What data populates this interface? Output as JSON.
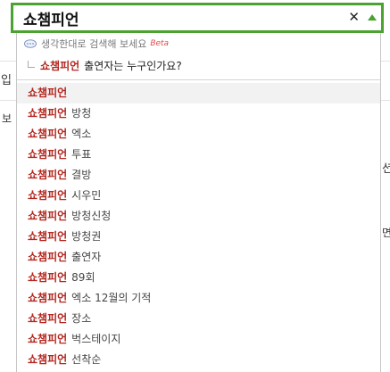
{
  "search": {
    "value": "쇼챔피언",
    "clear_symbol": "✕"
  },
  "dropdown": {
    "header": "생각한대로 검색해 보세요",
    "beta": "Beta",
    "question": {
      "keyword": "쇼챔피언",
      "rest": "출연자는 누구인가요?"
    },
    "items": [
      {
        "keyword": "쇼챔피언",
        "suffix": ""
      },
      {
        "keyword": "쇼챔피언",
        "suffix": "방청"
      },
      {
        "keyword": "쇼챔피언",
        "suffix": "엑소"
      },
      {
        "keyword": "쇼챔피언",
        "suffix": "투표"
      },
      {
        "keyword": "쇼챔피언",
        "suffix": "결방"
      },
      {
        "keyword": "쇼챔피언",
        "suffix": "시우민"
      },
      {
        "keyword": "쇼챔피언",
        "suffix": "방청신청"
      },
      {
        "keyword": "쇼챔피언",
        "suffix": "방청권"
      },
      {
        "keyword": "쇼챔피언",
        "suffix": "출연자"
      },
      {
        "keyword": "쇼챔피언",
        "suffix": "89회"
      },
      {
        "keyword": "쇼챔피언",
        "suffix": "엑소 12월의 기적"
      },
      {
        "keyword": "쇼챔피언",
        "suffix": "장소"
      },
      {
        "keyword": "쇼챔피언",
        "suffix": "벅스테이지"
      },
      {
        "keyword": "쇼챔피언",
        "suffix": "선착순"
      }
    ]
  },
  "background": {
    "left_frag_1": "입",
    "left_frag_2": "보",
    "right_frag_1": "션",
    "right_frag_2": "면"
  },
  "colors": {
    "accent": "#4aa330",
    "keyword": "#b3261e"
  },
  "icons": {
    "chat": "speech-bubble-icon",
    "clear": "close-icon",
    "toggle": "triangle-up-icon"
  }
}
